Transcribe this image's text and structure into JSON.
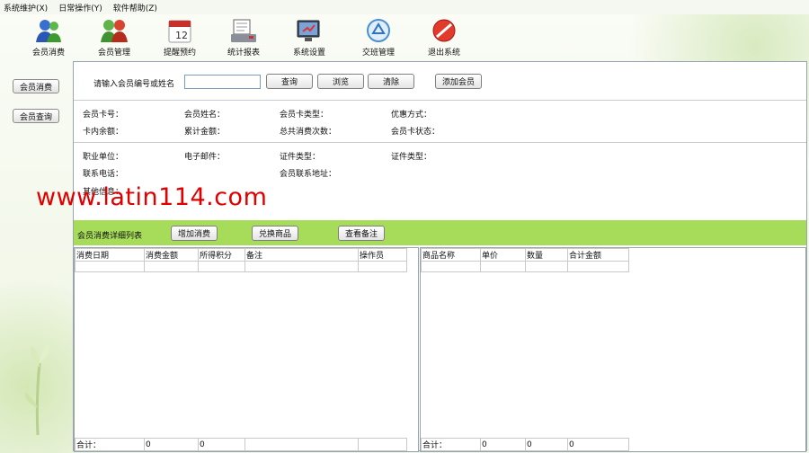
{
  "menu": [
    {
      "label": "系统维护(X)"
    },
    {
      "label": "日常操作(Y)"
    },
    {
      "label": "软件帮助(Z)"
    }
  ],
  "toolbar": [
    {
      "label": "会员消费",
      "icon": "users-icon"
    },
    {
      "label": "会员管理",
      "icon": "members-icon"
    },
    {
      "label": "提醒预约",
      "icon": "calendar-icon"
    },
    {
      "label": "统计报表",
      "icon": "report-icon"
    },
    {
      "label": "系统设置",
      "icon": "settings-icon"
    },
    {
      "label": "交班管理",
      "icon": "recycle-icon"
    },
    {
      "label": "退出系统",
      "icon": "exit-icon"
    }
  ],
  "sidebar": {
    "consume": "会员消费",
    "query": "会员查询"
  },
  "search": {
    "label": "请输入会员编号或姓名",
    "value": "",
    "query": "查询",
    "browse": "浏览",
    "clear": "清除",
    "add_member": "添加会员"
  },
  "info": {
    "card_no": "会员卡号：",
    "name": "会员姓名：",
    "card_type": "会员卡类型：",
    "discount": "优惠方式：",
    "balance": "卡内余额：",
    "total_amount": "累计金额：",
    "total_times": "总共消费次数：",
    "card_status": "会员卡状态：",
    "work_unit": "职业单位：",
    "email": "电子邮件：",
    "id_type": "证件类型：",
    "id_type2": "证件类型：",
    "phone": "联系电话：",
    "address": "会员联系地址：",
    "other": "其他信息："
  },
  "detail": {
    "title": "会员消费详细列表",
    "add_consume": "增加消费",
    "exchange": "兑换商品",
    "view_note": "查看备注"
  },
  "left_table": {
    "columns": [
      "消费日期",
      "消费金额",
      "所得积分",
      "备注",
      "操作员"
    ],
    "totals": [
      "合计：",
      "0",
      "0",
      "",
      ""
    ]
  },
  "right_table": {
    "columns": [
      "商品名称",
      "单价",
      "数量",
      "合计金额"
    ],
    "totals": [
      "合计：",
      "0",
      "0",
      "0"
    ]
  },
  "watermark": "www.latin114.com"
}
